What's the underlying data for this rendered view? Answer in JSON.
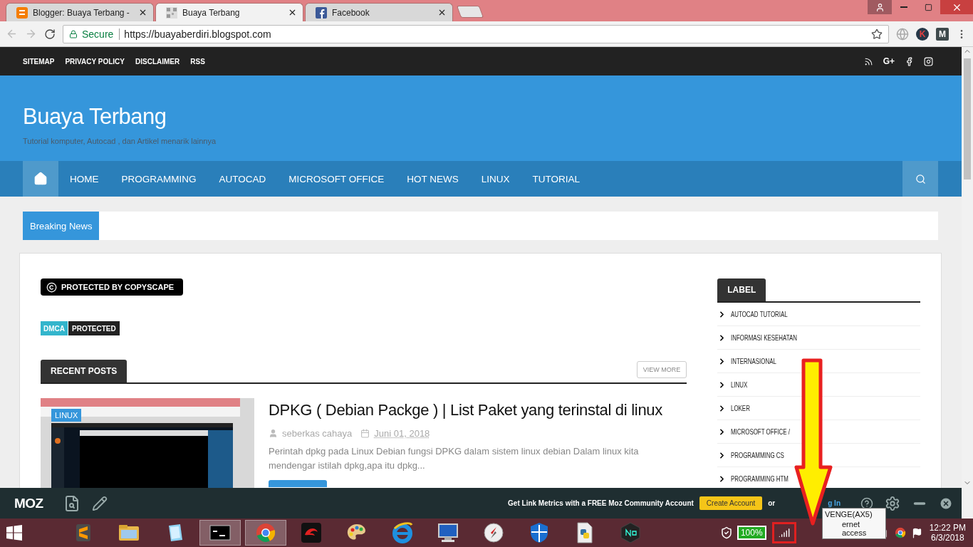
{
  "browser": {
    "tabs": [
      {
        "title": "Blogger: Buaya Terbang -",
        "selected": false
      },
      {
        "title": "Buaya Terbang",
        "selected": true
      },
      {
        "title": "Facebook",
        "selected": false
      }
    ],
    "secure_label": "Secure",
    "url": "https://buayaberdiri.blogspot.com",
    "extensions": [
      {
        "kind": "globe"
      },
      {
        "kind": "letter",
        "label": "K"
      },
      {
        "kind": "letter",
        "label": "M"
      }
    ]
  },
  "site": {
    "top_links": [
      "SITEMAP",
      "PRIVACY POLICY",
      "DISCLAIMER",
      "RSS"
    ],
    "social": [
      {
        "kind": "rss"
      },
      {
        "kind": "text",
        "label": "G+"
      },
      {
        "kind": "facebook"
      },
      {
        "kind": "instagram"
      }
    ],
    "title": "Buaya Terbang",
    "tagline": "Tutorial komputer, Autocad , dan Artikel menarik lainnya",
    "menu": {
      "home_selected": true,
      "items": [
        {
          "label": "HOME",
          "selected": false
        },
        {
          "label": "PROGRAMMING",
          "selected": false
        },
        {
          "label": "AUTOCAD",
          "selected": false
        },
        {
          "label": "MICROSOFT OFFICE",
          "selected": false
        },
        {
          "label": "HOT NEWS",
          "selected": false
        },
        {
          "label": "LINUX",
          "selected": false
        },
        {
          "label": "TUTORIAL",
          "selected": false
        }
      ]
    },
    "breaking_news": "Breaking News",
    "copyscape": "PROTECTED BY COPYSCAPE",
    "dmca": {
      "left": "DMCA",
      "right": "PROTECTED"
    },
    "recent_posts": {
      "heading": "RECENT POSTS",
      "view_more": "VIEW MORE",
      "posts": [
        {
          "category": "LINUX",
          "title": "DPKG ( Debian Packge ) | List Paket yang terinstal di linux",
          "author": "seberkas cahaya",
          "date": "Juni 01, 2018",
          "excerpt": "Perintah dpkg pada Linux Debian fungsi DPKG dalam sistem linux debian Dalam linux kita mendengar istilah dpkg,apa itu dpkg..."
        }
      ]
    },
    "sidebar": {
      "heading": "LABEL",
      "items": [
        "AUTOCAD TUTORIAL",
        "INFORMASI KESEHATAN",
        "INTERNASIONAL",
        "LINUX",
        "LOKER",
        "MICROSOFT OFFICE /",
        "PROGRAMMING CS",
        "PROGRAMMING HTM"
      ]
    }
  },
  "moz_bar": {
    "logo": "MOZ",
    "message": "Get Link Metrics with a FREE Moz Community Account",
    "create_account": "Create Account",
    "or": "or",
    "login": "g In"
  },
  "taskbar": {
    "apps": [
      {
        "selected": false
      },
      {
        "selected": false
      },
      {
        "selected": false
      },
      {
        "selected": true
      },
      {
        "selected": true
      },
      {
        "selected": false
      },
      {
        "selected": false
      },
      {
        "selected": false
      },
      {
        "selected": false
      },
      {
        "selected": false
      },
      {
        "selected": false
      },
      {
        "selected": false
      },
      {
        "selected": false
      }
    ],
    "battery": "100%",
    "tooltip": {
      "network": "VENGE(AX5)",
      "status": "ernet access"
    },
    "time": "12:22 PM",
    "date": "6/3/2018"
  }
}
